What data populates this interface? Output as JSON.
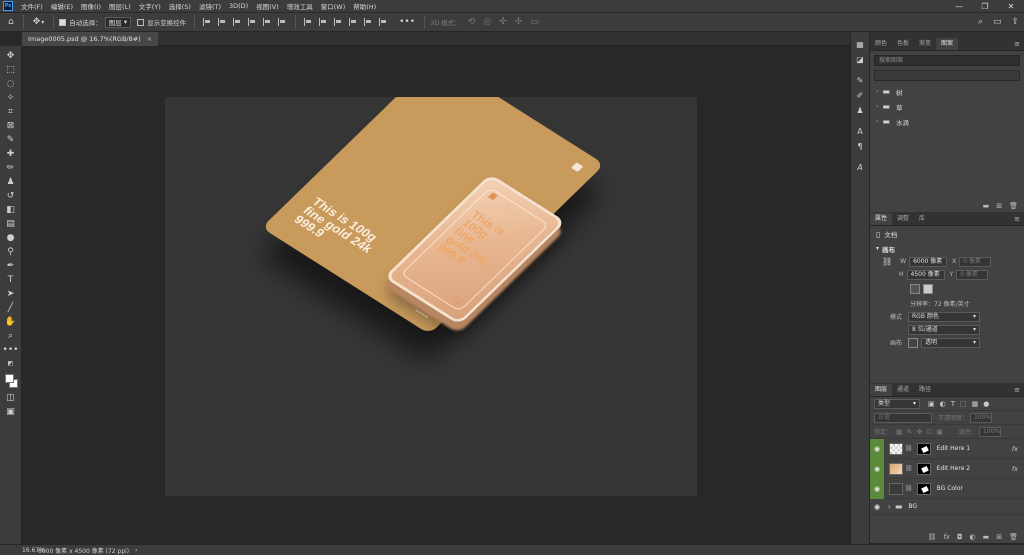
{
  "menubar": {
    "logo": "Ps",
    "items": [
      "文件(F)",
      "编辑(E)",
      "图像(I)",
      "图层(L)",
      "文字(Y)",
      "选择(S)",
      "滤镜(T)",
      "3D(D)",
      "视图(V)",
      "增效工具",
      "窗口(W)",
      "帮助(H)"
    ],
    "window_controls": [
      "—",
      "❐",
      "✕"
    ]
  },
  "options": {
    "auto_select_label": "自动选择：",
    "auto_select_value": "图层",
    "show_transform_label": "显示变换控件",
    "mode_3d_label": "3D 模式："
  },
  "document": {
    "tab_title": "Image0005.psd @ 16.7%(RGB/8#)",
    "close": "×"
  },
  "artwork": {
    "card_text_lines": [
      "This is 100g",
      "fine gold 24k",
      "999.9"
    ],
    "bar_text_lines": [
      "This is",
      "100g",
      "fine",
      "gold 24k",
      "999.9"
    ]
  },
  "libraries": {
    "tabs": [
      "颜色",
      "色板",
      "渐变",
      "图案"
    ],
    "search_placeholder": "搜索图案",
    "folders": [
      "树",
      "草",
      "水滴"
    ]
  },
  "properties": {
    "tabs": [
      "属性",
      "调整",
      "库"
    ],
    "doc_label": "文档",
    "section": "画布",
    "width_label": "W",
    "width_value": "6000 像素",
    "x_label": "X",
    "x_value": "0 像素",
    "height_label": "H",
    "height_value": "4500 像素",
    "y_label": "Y",
    "y_value": "0 像素",
    "resolution": "分辨率：72 像素/英寸",
    "mode_label": "模式",
    "mode_value": "RGB 颜色",
    "depth_value": "8 位/通道",
    "fill_label": "画布",
    "fill_value": "透明"
  },
  "layers": {
    "tabs": [
      "图层",
      "通道",
      "路径"
    ],
    "filter_value": "类型",
    "blend_mode": "正常",
    "opacity_label": "不透明度：",
    "opacity_value": "100%",
    "lock_label": "锁定：",
    "fill_label": "填充：",
    "fill_value": "100%",
    "items": [
      {
        "name": "Edit Here 1",
        "fx": "fx"
      },
      {
        "name": "Edit Here 2",
        "fx": "fx"
      },
      {
        "name": "BG Color",
        "fx": ""
      },
      {
        "name": "BG",
        "fx": ""
      }
    ]
  },
  "status": {
    "zoom": "16.67%",
    "doc_size": "6000 像素 x 4500 像素 (72 ppi)",
    "arrow": "›"
  },
  "colors": {
    "accent_green": "#5b8a3a",
    "gold_card": "#c89a5c",
    "gold_bar": "#e8b792"
  }
}
